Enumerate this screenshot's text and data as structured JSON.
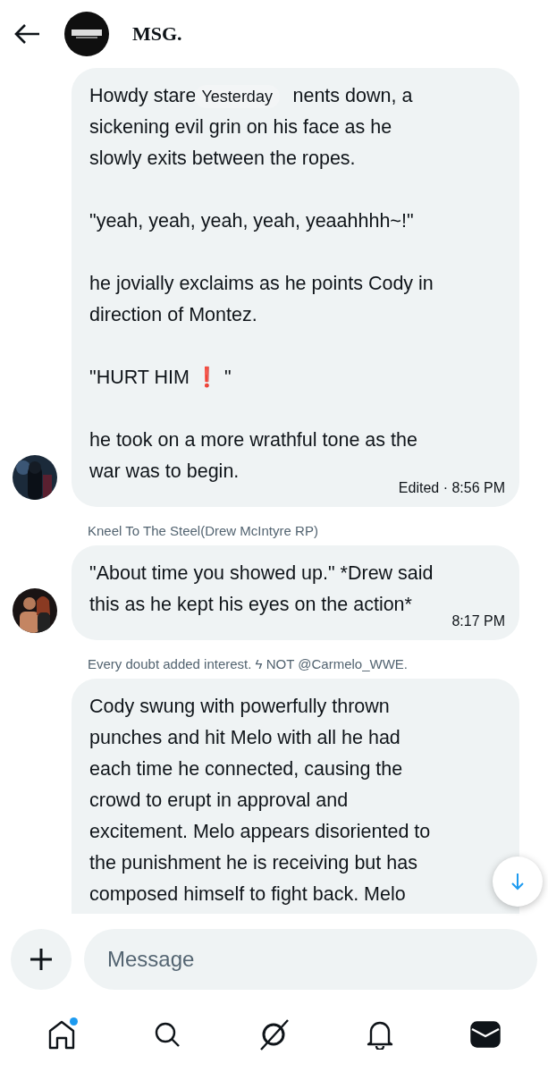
{
  "header": {
    "title": "MSG."
  },
  "date_pill": "Yesterday",
  "messages": [
    {
      "cut": false,
      "first_line": {
        "before": "Howdy stare",
        "after": "nents down, a"
      },
      "paragraphs": [
        [
          "sickening evil grin on his face as he",
          "slowly exits between the ropes."
        ],
        [
          "\"yeah, yeah, yeah, yeah, yeaahhhh~!\""
        ],
        [
          "he jovially exclaims as he points Cody in",
          "direction of Montez."
        ],
        [
          "\"HURT HIM ❗ \""
        ],
        [
          "he took on a more wrathful tone as the",
          "war was to begin."
        ]
      ],
      "time": "Edited · 8:56 PM"
    },
    {
      "sender": "Kneel To The Steel(Drew McIntyre RP)",
      "cut": false,
      "paragraphs": [
        [
          "\"About time you showed up.\" *Drew said",
          "this as he kept his eyes on the action*"
        ]
      ],
      "time": "8:17 PM"
    },
    {
      "sender": "Every doubt added interest. ϟ NOT @Carmelo_WWE.",
      "cut": true,
      "paragraphs": [
        [
          "Cody swung with powerfully thrown",
          "punches and hit Melo with all he had",
          "each time he connected, causing the",
          "crowd to erupt in approval and",
          "excitement. Melo appears disoriented to",
          "the punishment he is receiving but has",
          "composed himself to fight back. Melo"
        ]
      ]
    }
  ],
  "composer": {
    "placeholder": "Message"
  },
  "nav": [
    {
      "selected": false,
      "badge": true
    },
    {
      "selected": false,
      "badge": false
    },
    {
      "selected": false,
      "badge": false
    },
    {
      "selected": false,
      "badge": false
    },
    {
      "selected": true,
      "badge": false
    }
  ]
}
